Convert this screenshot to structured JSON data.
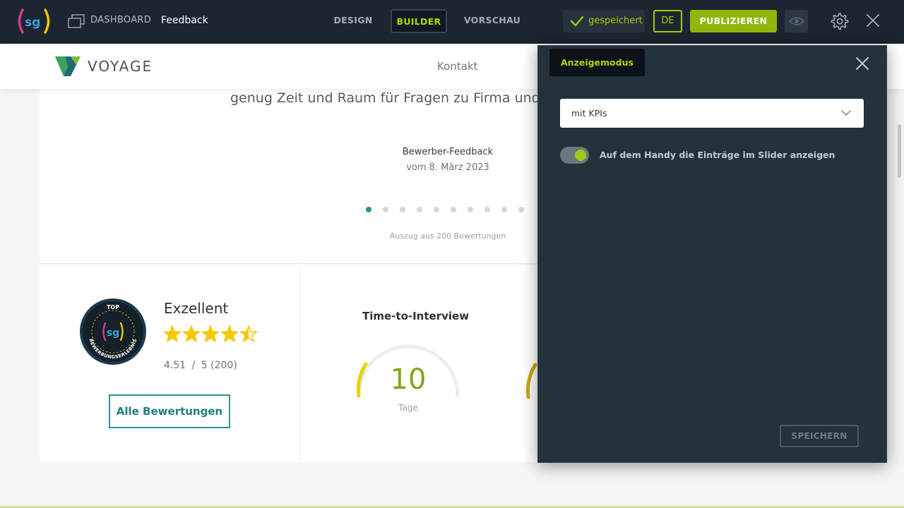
{
  "topbar": {
    "logo_text": "sg",
    "dashboard_label": "DASHBOARD",
    "page_label": "Feedback",
    "tabs": [
      {
        "label": "DESIGN"
      },
      {
        "label": "BUILDER",
        "active": true
      },
      {
        "label": "VORSCHAU"
      }
    ],
    "saved_label": "gespeichert",
    "language": "DE",
    "publish_label": "PUBLIZIEREN",
    "icons": {
      "preview": "eye-icon",
      "settings": "gear-icon",
      "close": "close-icon"
    }
  },
  "site": {
    "brand": "VOYAGE",
    "nav_link": "Kontakt",
    "quote_text": "genug Zeit und Raum für Fragen zu Firma und",
    "feedback_title": "Bewerber-Feedback",
    "feedback_date": "vom 8. März 2023",
    "slider_dot_count": 10,
    "slider_active_index": 0,
    "excerpt_text": "Auszug aus 200 Bewertungen",
    "badge": {
      "top_text": "TOP",
      "center_text": "sg",
      "bottom_text": "BEWERBUNGSERLEBNIS"
    },
    "rating": {
      "title": "Exzellent",
      "stars": 4.5,
      "max_stars": 5,
      "score": "4.51",
      "separator": "/",
      "max_count_text": "5 (200)",
      "button_label": "Alle Bewertungen"
    },
    "kpi": {
      "title": "Time-to-Interview",
      "value": "10",
      "unit": "Tage"
    }
  },
  "panel": {
    "tab_label": "Anzeigemodus",
    "select_value": "mit KPIs",
    "toggle_label": "Auf dem Handy die Einträge im Slider anzeigen",
    "toggle_on": true,
    "save_label": "SPEICHERN"
  },
  "colors": {
    "topbar_bg": "#1b2631",
    "accent_green": "#a7cc00",
    "publish_green": "#91b70c",
    "teal": "#2b9290",
    "panel_bg": "#23323b",
    "star_yellow": "#f5c800"
  }
}
